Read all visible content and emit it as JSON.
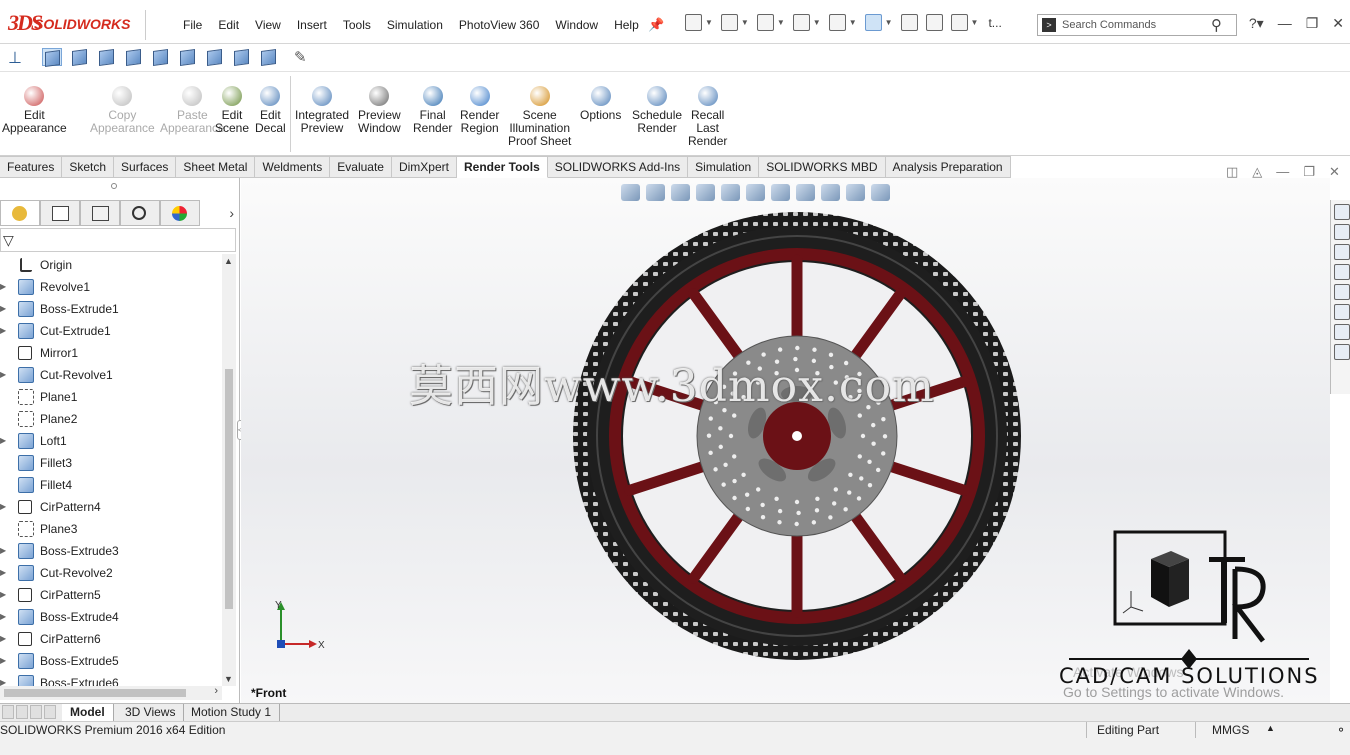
{
  "app": {
    "logo_mark": "3DS",
    "logo_text": "SOLIDWORKS"
  },
  "menu": [
    "File",
    "Edit",
    "View",
    "Insert",
    "Tools",
    "Simulation",
    "PhotoView 360",
    "Window",
    "Help"
  ],
  "quick_access": {
    "more_label": "t..."
  },
  "search": {
    "placeholder": "Search Commands"
  },
  "ribbon": {
    "buttons": [
      {
        "label": "Edit\nAppearance",
        "enabled": true
      },
      {
        "label": "Copy\nAppearance",
        "enabled": false
      },
      {
        "label": "Paste\nAppearance",
        "enabled": false
      },
      {
        "label": "Edit\nScene",
        "enabled": true
      },
      {
        "label": "Edit\nDecal",
        "enabled": true
      },
      {
        "label": "Integrated\nPreview",
        "enabled": true
      },
      {
        "label": "Preview\nWindow",
        "enabled": true
      },
      {
        "label": "Final\nRender",
        "enabled": true
      },
      {
        "label": "Render\nRegion",
        "enabled": true
      },
      {
        "label": "Scene\nIllumination\nProof Sheet",
        "enabled": true
      },
      {
        "label": "Options",
        "enabled": true
      },
      {
        "label": "Schedule\nRender",
        "enabled": true
      },
      {
        "label": "Recall\nLast\nRender",
        "enabled": true
      }
    ]
  },
  "command_tabs": [
    {
      "label": "Features",
      "active": false
    },
    {
      "label": "Sketch",
      "active": false
    },
    {
      "label": "Surfaces",
      "active": false
    },
    {
      "label": "Sheet Metal",
      "active": false
    },
    {
      "label": "Weldments",
      "active": false
    },
    {
      "label": "Evaluate",
      "active": false
    },
    {
      "label": "DimXpert",
      "active": false
    },
    {
      "label": "Render Tools",
      "active": true
    },
    {
      "label": "SOLIDWORKS Add-Ins",
      "active": false
    },
    {
      "label": "Simulation",
      "active": false
    },
    {
      "label": "SOLIDWORKS MBD",
      "active": false
    },
    {
      "label": "Analysis Preparation",
      "active": false
    }
  ],
  "feature_tree": [
    {
      "label": "Origin",
      "icon": "origin-icon",
      "expandable": false
    },
    {
      "label": "Revolve1",
      "icon": "revolve-icon",
      "expandable": true
    },
    {
      "label": "Boss-Extrude1",
      "icon": "boss-extrude-icon",
      "expandable": true
    },
    {
      "label": "Cut-Extrude1",
      "icon": "cut-extrude-icon",
      "expandable": true
    },
    {
      "label": "Mirror1",
      "icon": "mirror-icon",
      "expandable": false
    },
    {
      "label": "Cut-Revolve1",
      "icon": "cut-revolve-icon",
      "expandable": true
    },
    {
      "label": "Plane1",
      "icon": "plane-icon",
      "expandable": false
    },
    {
      "label": "Plane2",
      "icon": "plane-icon",
      "expandable": false
    },
    {
      "label": "Loft1",
      "icon": "loft-icon",
      "expandable": true
    },
    {
      "label": "Fillet3",
      "icon": "fillet-icon",
      "expandable": false
    },
    {
      "label": "Fillet4",
      "icon": "fillet-icon",
      "expandable": false
    },
    {
      "label": "CirPattern4",
      "icon": "circular-pattern-icon",
      "expandable": true
    },
    {
      "label": "Plane3",
      "icon": "plane-icon",
      "expandable": false
    },
    {
      "label": "Boss-Extrude3",
      "icon": "boss-extrude-icon",
      "expandable": true
    },
    {
      "label": "Cut-Revolve2",
      "icon": "cut-revolve-icon",
      "expandable": true
    },
    {
      "label": "CirPattern5",
      "icon": "circular-pattern-icon",
      "expandable": true
    },
    {
      "label": "Boss-Extrude4",
      "icon": "boss-extrude-icon",
      "expandable": true
    },
    {
      "label": "CirPattern6",
      "icon": "circular-pattern-icon",
      "expandable": true
    },
    {
      "label": "Boss-Extrude5",
      "icon": "boss-extrude-icon",
      "expandable": true
    },
    {
      "label": "Boss-Extrude6",
      "icon": "boss-extrude-icon",
      "expandable": true
    }
  ],
  "graphics": {
    "view_name": "*Front",
    "watermark": "莫西网www.3dmox.com",
    "triad_x": "X",
    "triad_y": "Y",
    "brand_text": "CAD/CAM SOLUTIONS",
    "activate_title": "Activate Windows",
    "activate_hint": "Go to Settings to activate Windows.",
    "rim_color": "#6b1116",
    "tire_color": "#1e1e1e",
    "disc_color": "#8a8a8a"
  },
  "bottom_tabs": [
    {
      "label": "Model",
      "active": true
    },
    {
      "label": "3D Views",
      "active": false
    },
    {
      "label": "Motion Study 1",
      "active": false
    }
  ],
  "status": {
    "edition": "SOLIDWORKS Premium 2016 x64 Edition",
    "mode": "Editing Part",
    "units": "MMGS"
  }
}
